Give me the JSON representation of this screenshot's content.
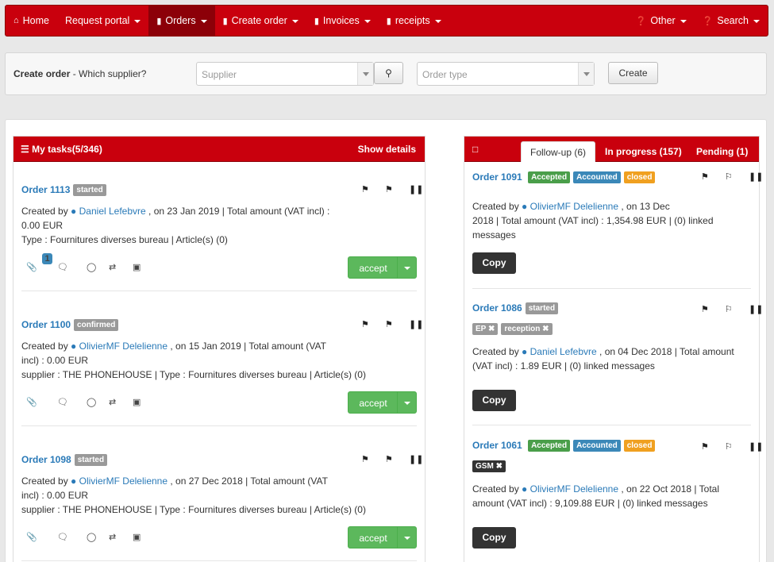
{
  "nav": {
    "left": [
      {
        "label": "Home",
        "icon": "home-icon"
      },
      {
        "label": "Request portal",
        "caret": true
      },
      {
        "label": "Orders",
        "icon": "book-icon",
        "caret": true,
        "active": true
      },
      {
        "label": "Create order",
        "icon": "book-icon",
        "caret": true
      },
      {
        "label": "Invoices",
        "icon": "book-icon",
        "caret": true
      },
      {
        "label": "receipts",
        "icon": "book-icon",
        "caret": true
      }
    ],
    "right": [
      {
        "label": "Other",
        "icon": "question-icon",
        "caret": true
      },
      {
        "label": "Search",
        "icon": "question-icon",
        "caret": true
      }
    ]
  },
  "create": {
    "title": "Create order",
    "subtitle": " - Which supplier?",
    "supplier_placeholder": "Supplier",
    "ordertype_placeholder": "Order type",
    "create_label": "Create"
  },
  "tasks": {
    "title": "My tasks(5/346)",
    "show_details": "Show details",
    "accept_label": "accept",
    "items": [
      {
        "order": "Order 1113",
        "status": "started",
        "line1_pre": "Created by ",
        "user": "Daniel Lefebvre",
        "line1_post": " , on 23 Jan 2019 |  Total amount (VAT incl) :",
        "line2": "0.00  EUR",
        "line3": "Type :  Fournitures diverses bureau |  Article(s) (0)",
        "attach_count": "1"
      },
      {
        "order": "Order 1100",
        "status": "confirmed",
        "line1_pre": "Created by ",
        "user": "OlivierMF Delelienne",
        "line1_post": " , on 15 Jan 2019 |  Total amount (VAT",
        "line2": "incl) :  0.00  EUR",
        "line3": "supplier :  THE PHONEHOUSE |  Type :  Fournitures diverses bureau |  Article(s) (0)"
      },
      {
        "order": "Order 1098",
        "status": "started",
        "line1_pre": "Created by ",
        "user": "OlivierMF Delelienne",
        "line1_post": " , on 27 Dec 2018 |  Total amount (VAT",
        "line2": "incl) :  0.00  EUR",
        "line3": "supplier :  THE PHONEHOUSE |  Type :  Fournitures diverses bureau |  Article(s) (0)"
      }
    ]
  },
  "followup": {
    "tabs": [
      "Follow-up (6)",
      "In progress (157)",
      "Pending (1)"
    ],
    "copy_label": "Copy",
    "items": [
      {
        "order": "Order 1091",
        "badges": [
          "Accepted",
          "Accounted",
          "closed"
        ],
        "line1_pre": "Created by ",
        "user": "OlivierMF Delelienne",
        "line1_post": " , on 13 Dec",
        "line2": "2018 | Total amount (VAT incl)  : 1,354.98  EUR | (0) linked",
        "line3": "messages"
      },
      {
        "order": "Order 1086",
        "badges": [
          "started"
        ],
        "tags": [
          "EP",
          "reception"
        ],
        "line1_pre": "Created by ",
        "user": "Daniel Lefebvre",
        "line1_post": " , on 04 Dec 2018 | Total amount",
        "line2": "(VAT incl)  : 1.89  EUR | (0) linked messages"
      },
      {
        "order": "Order 1061",
        "badges": [
          "Accepted",
          "Accounted",
          "closed"
        ],
        "tags": [
          "GSM"
        ],
        "line1_pre": "Created by ",
        "user": "OlivierMF Delelienne",
        "line1_post": " , on 22 Oct 2018 | Total",
        "line2": "amount (VAT incl)  : 9,109.88  EUR | (0) linked messages"
      }
    ]
  }
}
